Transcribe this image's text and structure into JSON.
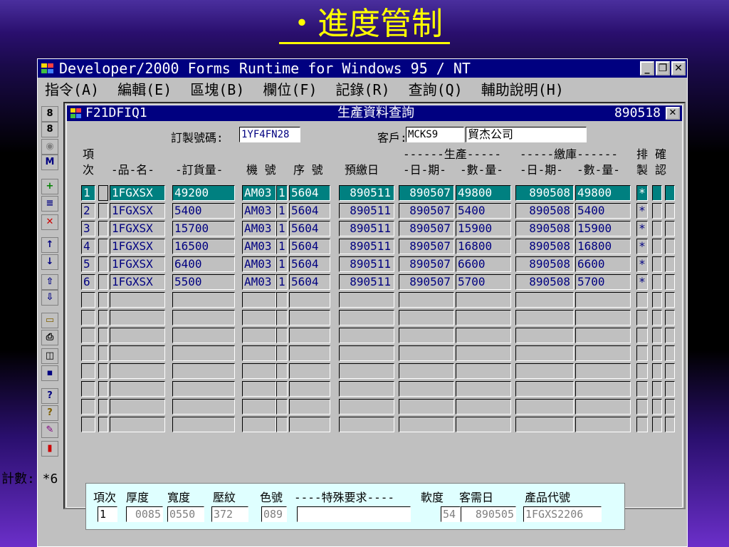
{
  "slide_title": "・進度管制",
  "window": {
    "title": "Developer/2000 Forms Runtime for Windows 95 / NT",
    "minimize": "_",
    "restore": "❐",
    "close": "✕"
  },
  "menu": [
    "指令(A)",
    "編輯(E)",
    "區塊(B)",
    "欄位(F)",
    "記錄(R)",
    "查詢(Q)",
    "輔助說明(H)"
  ],
  "form": {
    "id": "F21DFIQ1",
    "name": "生產資料查詢",
    "date": "890518",
    "close": "✕",
    "order_label": "訂製號碼:",
    "order_value": "1YF4FN28",
    "customer_label": "客戶:",
    "customer_code": "MCKS9",
    "customer_name": "貿杰公司"
  },
  "headers": {
    "item_top": "項",
    "item_bottom": "次",
    "product": "-品-名-",
    "order_qty": "-訂貨量-",
    "machine": "機 號",
    "seq": "序 號",
    "planned": "預繳日",
    "production_group": "------生產-----",
    "prod_date": "-日-期-",
    "prod_qty": "-數-量-",
    "delivery_group": "-----繳庫------",
    "del_date": "-日-期-",
    "del_qty": "-數-量-",
    "sched_top": "排",
    "sched_bottom": "製",
    "confirm_top": "確",
    "confirm_bottom": "認"
  },
  "rows": [
    {
      "no": "1",
      "product": "1FGXSX",
      "order_qty": "49200",
      "machine": "AM03",
      "m2": "1",
      "seq": "5604",
      "planned": "890511",
      "prod_date": "890507",
      "prod_qty": "49800",
      "del_date": "890508",
      "del_qty": "49800",
      "sched": "*"
    },
    {
      "no": "2",
      "product": "1FGXSX",
      "order_qty": "5400",
      "machine": "AM03",
      "m2": "1",
      "seq": "5604",
      "planned": "890511",
      "prod_date": "890507",
      "prod_qty": "5400",
      "del_date": "890508",
      "del_qty": "5400",
      "sched": "*"
    },
    {
      "no": "3",
      "product": "1FGXSX",
      "order_qty": "15700",
      "machine": "AM03",
      "m2": "1",
      "seq": "5604",
      "planned": "890511",
      "prod_date": "890507",
      "prod_qty": "15900",
      "del_date": "890508",
      "del_qty": "15900",
      "sched": "*"
    },
    {
      "no": "4",
      "product": "1FGXSX",
      "order_qty": "16500",
      "machine": "AM03",
      "m2": "1",
      "seq": "5604",
      "planned": "890511",
      "prod_date": "890507",
      "prod_qty": "16800",
      "del_date": "890508",
      "del_qty": "16800",
      "sched": "*"
    },
    {
      "no": "5",
      "product": "1FGXSX",
      "order_qty": "6400",
      "machine": "AM03",
      "m2": "1",
      "seq": "5604",
      "planned": "890511",
      "prod_date": "890507",
      "prod_qty": "6600",
      "del_date": "890508",
      "del_qty": "6600",
      "sched": "*"
    },
    {
      "no": "6",
      "product": "1FGXSX",
      "order_qty": "5500",
      "machine": "AM03",
      "m2": "1",
      "seq": "5604",
      "planned": "890511",
      "prod_date": "890507",
      "prod_qty": "5700",
      "del_date": "890508",
      "del_qty": "5700",
      "sched": "*"
    }
  ],
  "empty_row_count": 8,
  "detail": {
    "labels": [
      "項次",
      "厚度",
      "寬度",
      "壓紋",
      "色號",
      "----特殊要求----",
      "軟度",
      "客需日",
      "產品代號"
    ],
    "values": [
      "1",
      "0085",
      "0550",
      "372",
      "089",
      "",
      "54",
      "890505",
      "1FGXS2206"
    ]
  },
  "status": "計數: *6",
  "toolbar_icons": [
    "enter-query-icon",
    "execute-query-icon",
    "cancel-query-icon",
    "search-icon",
    "insert-record-icon",
    "duplicate-record-icon",
    "delete-record-icon",
    "previous-record-icon",
    "next-record-icon",
    "previous-block-icon",
    "next-block-icon",
    "open-icon",
    "print-icon",
    "list-icon",
    "save-icon",
    "help-icon",
    "keys-icon",
    "clear-icon",
    "exit-icon"
  ],
  "colors": {
    "title_bar": "#000080",
    "selected_row": "#008080",
    "slide_title": "#ffff00",
    "detail_panel": "#dfffff"
  }
}
